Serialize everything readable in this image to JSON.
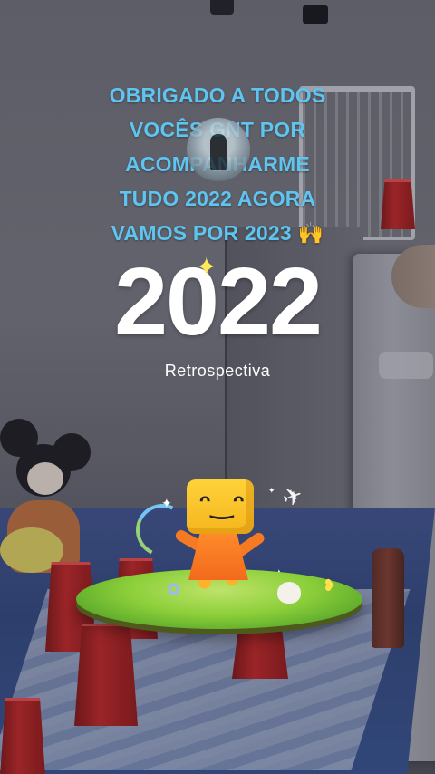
{
  "caption": {
    "line1": "OBRIGADO A TODOS",
    "line2": "VOCÊS GNT POR",
    "line3": "ACOMPANHARME",
    "line4": "TUDO 2022 AGORA",
    "line5": "VAMOS POR 2023 🙌",
    "color": "#5ec4f0"
  },
  "recap": {
    "year": "2022",
    "subtitle": "Retrospectiva",
    "sparkle_icon": "sparkle-icon",
    "mascot_face": "ᵔ‿ᵔ"
  },
  "icons": {
    "paper_plane": "✈",
    "star": "✦",
    "flower": "✿",
    "leaf": "❥"
  }
}
